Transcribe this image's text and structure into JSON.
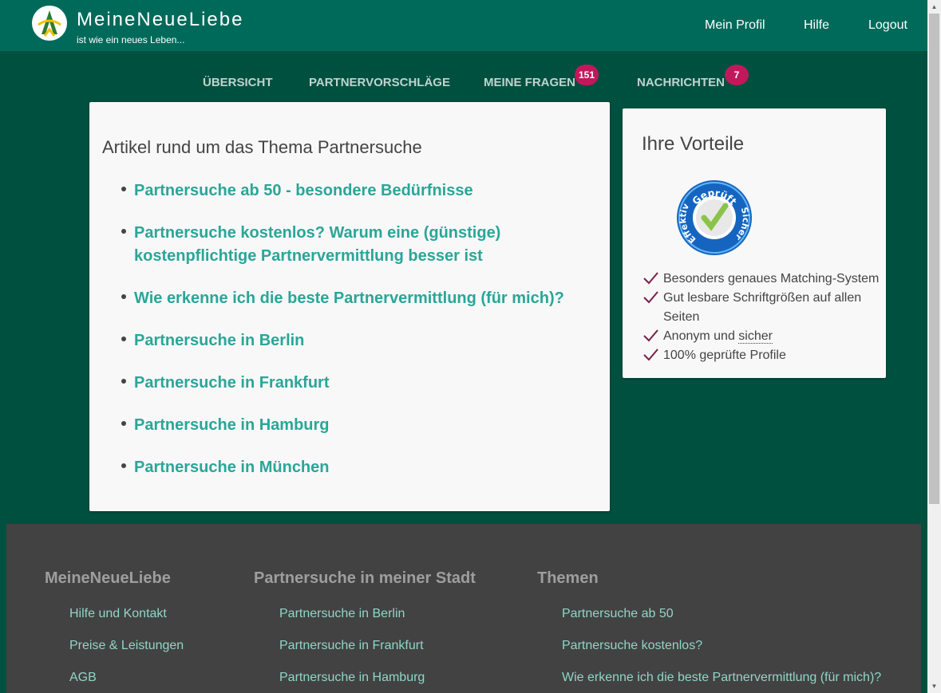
{
  "brand": {
    "name": "MeineNeueLiebe",
    "tagline": "ist wie ein neues Leben..."
  },
  "topnav": {
    "profile": "Mein Profil",
    "help": "Hilfe",
    "logout": "Logout"
  },
  "mainnav": {
    "overview": "ÜBERSICHT",
    "suggestions": "PARTNERVORSCHLÄGE",
    "questions": "MEINE FRAGEN",
    "questions_badge": "151",
    "messages": "NACHRICHTEN",
    "messages_badge": "7"
  },
  "articles": {
    "title": "Artikel rund um das Thema Partnersuche",
    "items": [
      "Partnersuche ab 50 - besondere Bedürfnisse",
      "Partnersuche kostenlos? Warum eine (günstige) kostenpflichtige Partnervermittlung besser ist",
      "Wie erkenne ich die beste Partnervermittlung (für mich)?",
      "Partnersuche in Berlin",
      "Partnersuche in Frankfurt",
      "Partnersuche in Hamburg",
      "Partnersuche in München"
    ]
  },
  "benefits": {
    "title": "Ihre Vorteile",
    "seal": {
      "top": "Geprüft",
      "left": "Effektiv",
      "right": "Sicher"
    },
    "items": [
      "Besonders genaues Matching-System",
      "Gut lesbare Schriftgrößen auf allen Seiten",
      "Anonym und",
      "sicher",
      "100% geprüfte Profile"
    ]
  },
  "footer": {
    "col1": {
      "title": "MeineNeueLiebe",
      "links": [
        "Hilfe und Kontakt",
        "Preise & Leistungen",
        "AGB"
      ]
    },
    "col2": {
      "title": "Partnersuche in meiner Stadt",
      "links": [
        "Partnersuche in Berlin",
        "Partnersuche in Frankfurt",
        "Partnersuche in Hamburg"
      ]
    },
    "col3": {
      "title": "Themen",
      "links": [
        "Partnersuche ab 50",
        "Partnersuche kostenlos?",
        "Wie erkenne ich die beste Partnervermittlung (für mich)?"
      ]
    }
  },
  "colors": {
    "header": "#006a5a",
    "background": "#00503f",
    "link": "#2aa698",
    "badge": "#c2185b",
    "footer": "#424242",
    "check": "#7a1f4a"
  },
  "icons": [
    "brand-logo-icon",
    "seal-icon",
    "check-icon",
    "scroll-up-icon",
    "scroll-down-icon"
  ]
}
